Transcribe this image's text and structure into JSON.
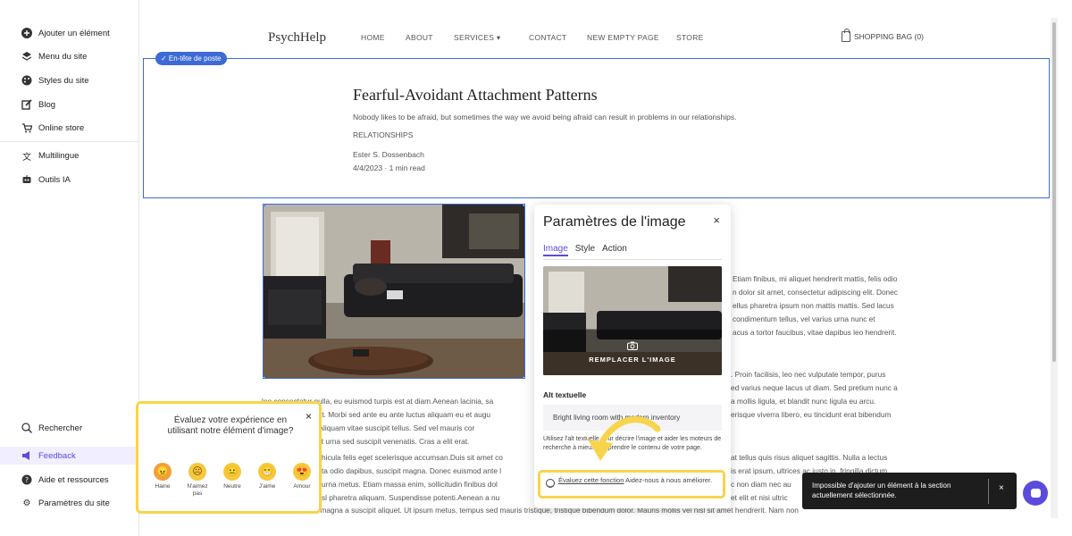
{
  "sidebar": {
    "items": [
      {
        "label": "Ajouter un élément",
        "icon": "plus-circle-icon"
      },
      {
        "label": "Menu du site",
        "icon": "layers-icon"
      },
      {
        "label": "Styles du site",
        "icon": "palette-icon"
      },
      {
        "label": "Blog",
        "icon": "edit-icon"
      },
      {
        "label": "Online store",
        "icon": "cart-icon"
      },
      {
        "label": "Multilingue",
        "icon": "translate-icon"
      },
      {
        "label": "Outils IA",
        "icon": "robot-icon"
      }
    ],
    "bottom_items": [
      {
        "label": "Rechercher",
        "icon": "search-icon"
      },
      {
        "label": "Feedback",
        "icon": "megaphone-icon"
      },
      {
        "label": "Aide et ressources",
        "icon": "help-icon"
      },
      {
        "label": "Paramètres du site",
        "icon": "gear-icon"
      }
    ],
    "accent_color": "#5b4bdb"
  },
  "site": {
    "logo": "PsychHelp",
    "nav": [
      "HOME",
      "ABOUT",
      "SERVICES  ▾",
      "CONTACT",
      "NEW EMPTY PAGE",
      "STORE"
    ],
    "bag": "SHOPPING BAG (0)"
  },
  "post_header": {
    "badge": "✓ En-tête de poste",
    "title": "Fearful-Avoidant Attachment Patterns",
    "subtitle": "Nobody likes to be afraid, but sometimes the way we avoid being afraid can result in problems in our relationships.",
    "category": "RELATIONSHIPS",
    "author": "Ester S. Dossenbach",
    "date": "4/4/2023 · 1 min read"
  },
  "body_text": {
    "p1_right": [
      "Etiam finibus, mi aliquet hendrerit mattis, felis odio",
      "n dolor sit amet, consectetur adipiscing elit. Donec",
      "ellus pharetra ipsum non mattis mattis. Sed lacus",
      "condimentum tellus, vel varius urna nunc et",
      "acus a tortor faucibus, vitae dapibus leo hendrerit."
    ],
    "p2": [
      ". Proin facilisis, leo nec vulputate tempor, purus",
      "leo consectetur nulla, eu euismod turpis est at diam.Aenean lacinia, sa",
      "fermentum suscipit. Morbi sed ante eu ante luctus aliquam eu et augu",
      "a nisl. Aliquam vitae suscipit tellus. Sed vel mauris cor",
      "volutpat urna sed suscipit venenatis. Cras a elit erat."
    ],
    "p2_right": [
      ". Proin facilisis, leo nec vulputate tempor, purus",
      "ed varius neque lacus ut diam. Sed pretium nunc a",
      "a mollis ligula, et blandit nunc ligula eu arcu.",
      "erisque viverra libero, eu tincidunt erat bibendum"
    ],
    "p3": [
      "hicula felis eget scelerisque accumsan.Duis sit amet co",
      "ta odio dapibus, suscipit magna. Donec euismod ante l",
      "urna metus. Etiam massa enim, sollicitudin finibus dol",
      "sl pharetra aliquam. Suspendisse potenti.Aenean a nu",
      "leo. Cras non erit magna a suscipit aliquet. Ut ipsum metus, tempus sed mauris tristique, tristique bibendum dolor. Mauris mollis vel nisl sit amet hendrerit. Nam non"
    ],
    "p3_right": [
      "at tellus quis risus aliquet sagittis. Nulla a lectus",
      "is erat ipsum, ultrices ac justo in, fringilla dictum",
      "c non diam nec au",
      "et elit et nisi ultric"
    ]
  },
  "image_panel": {
    "title": "Paramètres de l'image",
    "close": "×",
    "tabs": [
      "Image",
      "Style",
      "Action"
    ],
    "replace_label": "REMPLACER L'IMAGE",
    "alt_label": "Alt textuelle",
    "alt_value": "Bright living room with modern inventory",
    "alt_help": "Utilisez l'alt textuelle pour décrire l'image et aider les moteurs de recherche à mieux comprendre le contenu de votre page.",
    "eval_link": "Évaluez cette fonction",
    "eval_text": " Aidez-nous à nous améliorer."
  },
  "survey": {
    "question": "Évaluez votre expérience en utilisant notre élément d'image?",
    "close": "×",
    "options": [
      {
        "label": "Haine",
        "icon": "angry-face-icon",
        "face": "😠"
      },
      {
        "label": "N'aimez pas",
        "icon": "sad-face-icon",
        "face": "☹"
      },
      {
        "label": "Neutre",
        "icon": "neutral-face-icon",
        "face": "😐"
      },
      {
        "label": "J'aime",
        "icon": "happy-face-icon",
        "face": "😁"
      },
      {
        "label": "Amour",
        "icon": "love-face-icon",
        "face": "😍"
      }
    ],
    "highlight_color": "#f8d44c"
  },
  "toast": {
    "text": "Impossible d'ajouter un élément à la section actuellement sélectionnée.",
    "close": "×"
  }
}
